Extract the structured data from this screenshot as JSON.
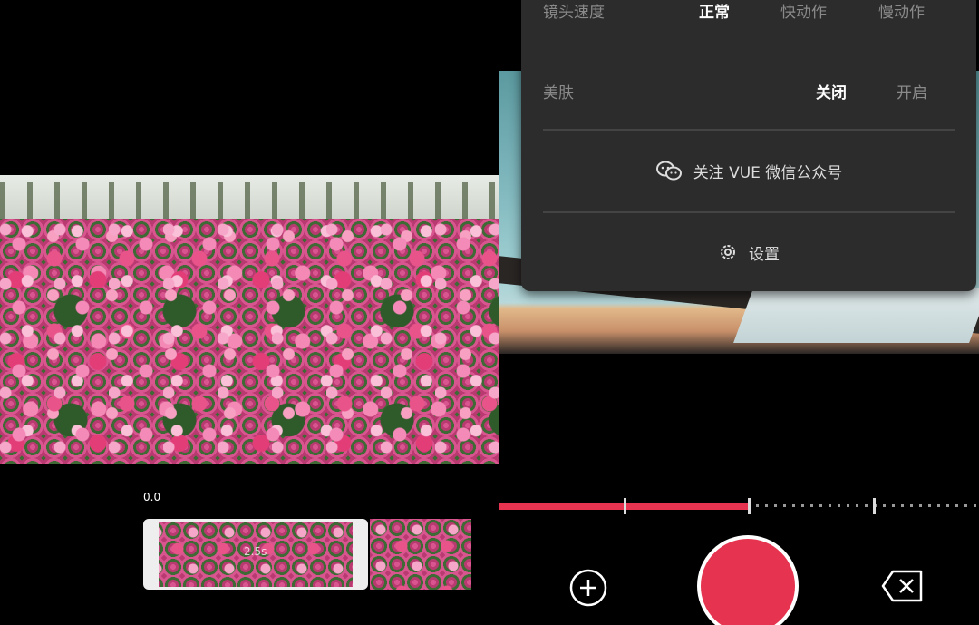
{
  "left": {
    "time_label": "0.0",
    "clip_duration": "2.5s"
  },
  "menu": {
    "speed": {
      "label": "镜头速度",
      "options": [
        "正常",
        "快动作",
        "慢动作"
      ],
      "selected": "正常"
    },
    "beauty": {
      "label": "美肤",
      "options": [
        "关闭",
        "开启"
      ],
      "selected": "关闭"
    },
    "wechat_link": "关注 VUE 微信公众号",
    "settings_link": "设置"
  },
  "recorder": {
    "progress_fraction": 0.52,
    "segment_marks": [
      0.26,
      0.52,
      0.78
    ]
  },
  "icons": {
    "wechat": "wechat-icon",
    "settings": "gear-icon",
    "add": "plus-circle-icon",
    "delete": "backspace-icon"
  },
  "colors": {
    "accent": "#e6334f",
    "menu_bg": "#2c2c2c",
    "inactive_text": "#8a8a8a"
  }
}
